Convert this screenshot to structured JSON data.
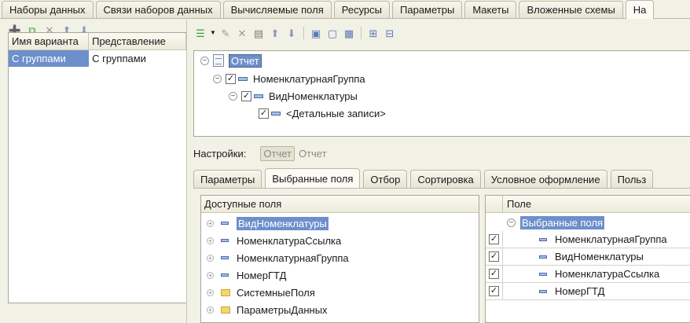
{
  "top_tabs": [
    "Наборы данных",
    "Связи наборов данных",
    "Вычисляемые поля",
    "Ресурсы",
    "Параметры",
    "Макеты",
    "Вложенные схемы",
    "На"
  ],
  "variants": {
    "headers": [
      "Имя варианта",
      "Представление"
    ],
    "rows": [
      {
        "name": "С группами",
        "presentation": "С группами"
      }
    ]
  },
  "structure": {
    "root": "Отчет",
    "group": "НоменклатурнаяГруппа",
    "subgroup": "ВидНоменклатуры",
    "detail": "<Детальные записи>"
  },
  "settings": {
    "label": "Настройки:",
    "chip": "Отчет",
    "value": "Отчет"
  },
  "sub_tabs": [
    "Параметры",
    "Выбранные поля",
    "Отбор",
    "Сортировка",
    "Условное оформление",
    "Польз"
  ],
  "available_fields": {
    "header": "Доступные поля",
    "items": [
      {
        "label": "ВидНоменклатуры",
        "icon": "field-icon"
      },
      {
        "label": "НоменклатураСсылка",
        "icon": "field-icon"
      },
      {
        "label": "НоменклатурнаяГруппа",
        "icon": "field-icon"
      },
      {
        "label": "НомерГТД",
        "icon": "field-icon"
      },
      {
        "label": "СистемныеПоля",
        "icon": "folder-icon"
      },
      {
        "label": "ПараметрыДанных",
        "icon": "folder-icon"
      }
    ]
  },
  "selected_fields": {
    "header": "Поле",
    "group_label": "Выбранные поля",
    "items": [
      "НоменклатурнаяГруппа",
      "ВидНоменклатуры",
      "НоменклатураСсылка",
      "НомерГТД"
    ]
  },
  "colors": {
    "selection": "#6d8fcb",
    "panel_bg": "#f2f1e6"
  }
}
